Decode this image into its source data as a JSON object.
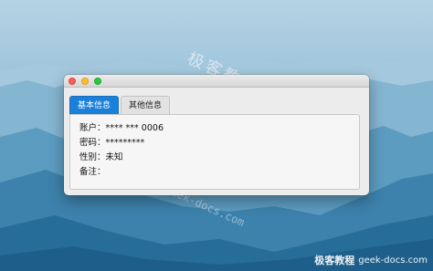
{
  "window": {
    "tabs": [
      {
        "label": "基本信息",
        "active": true
      },
      {
        "label": "其他信息",
        "active": false
      }
    ],
    "fields": [
      {
        "label": "账户：",
        "value": "**** *** 0006"
      },
      {
        "label": "密码：",
        "value": "*********"
      },
      {
        "label": "性别：",
        "value": "未知"
      },
      {
        "label": "备注：",
        "value": ""
      }
    ]
  },
  "watermarks": {
    "top": "极客教程",
    "middle": "geek-docs.com",
    "bottom_brand": "极客教程",
    "bottom_site": "geek-docs.com"
  },
  "colors": {
    "active_tab": "#1a80d9",
    "close": "#fc5f57",
    "minimize": "#fdbc2e",
    "maximize": "#28c840"
  }
}
